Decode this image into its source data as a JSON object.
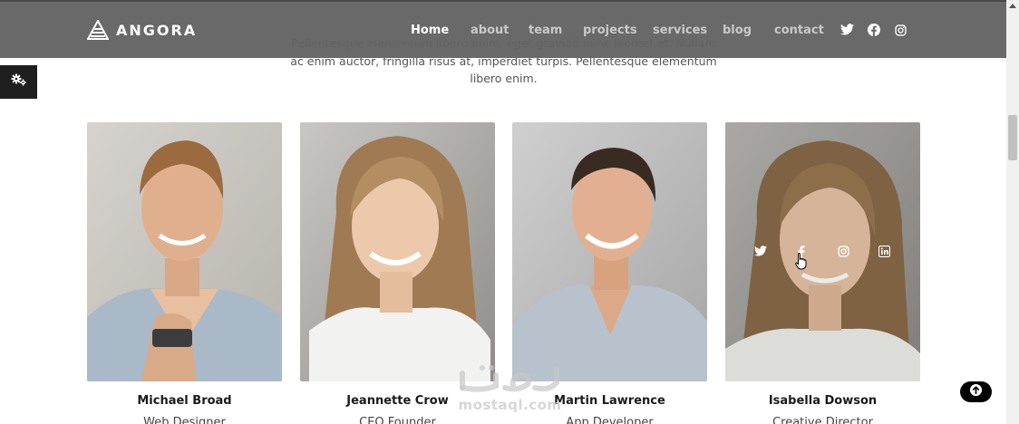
{
  "header": {
    "brand": "ANGORA",
    "nav": [
      {
        "label": "Home",
        "active": true
      },
      {
        "label": "about",
        "active": false
      },
      {
        "label": "team",
        "active": false
      },
      {
        "label": "projects",
        "active": false
      },
      {
        "label": "services",
        "active": false
      },
      {
        "label": "blog",
        "active": false
      },
      {
        "label": "contact",
        "active": false
      }
    ],
    "social_icons": [
      "twitter-icon",
      "facebook-icon",
      "instagram-icon"
    ]
  },
  "intro": {
    "text": "Pellentesque elementum libero enim, eget gravida nunc laoreet et. Nullam ac enim auctor, fringilla risus at, imperdiet turpis. Pellentesque elementum libero enim."
  },
  "team": [
    {
      "name": "Michael Broad",
      "role": "Web Designer"
    },
    {
      "name": "Jeannette Crow",
      "role": "CEO Founder"
    },
    {
      "name": "Martin Lawrence",
      "role": "App Developer"
    },
    {
      "name": "Isabella Dowson",
      "role": "Creative Director"
    }
  ],
  "card_overlay_icons": [
    "twitter-icon",
    "facebook-icon",
    "instagram-icon",
    "linkedin-icon"
  ],
  "watermark": {
    "text": "mostaql.com"
  },
  "colors": {
    "header_bg": "#646464",
    "nav_active": "#ffffff",
    "nav_inactive": "#c9c9c9",
    "settings_tab": "#1f1f1f",
    "to_top": "#000000"
  }
}
